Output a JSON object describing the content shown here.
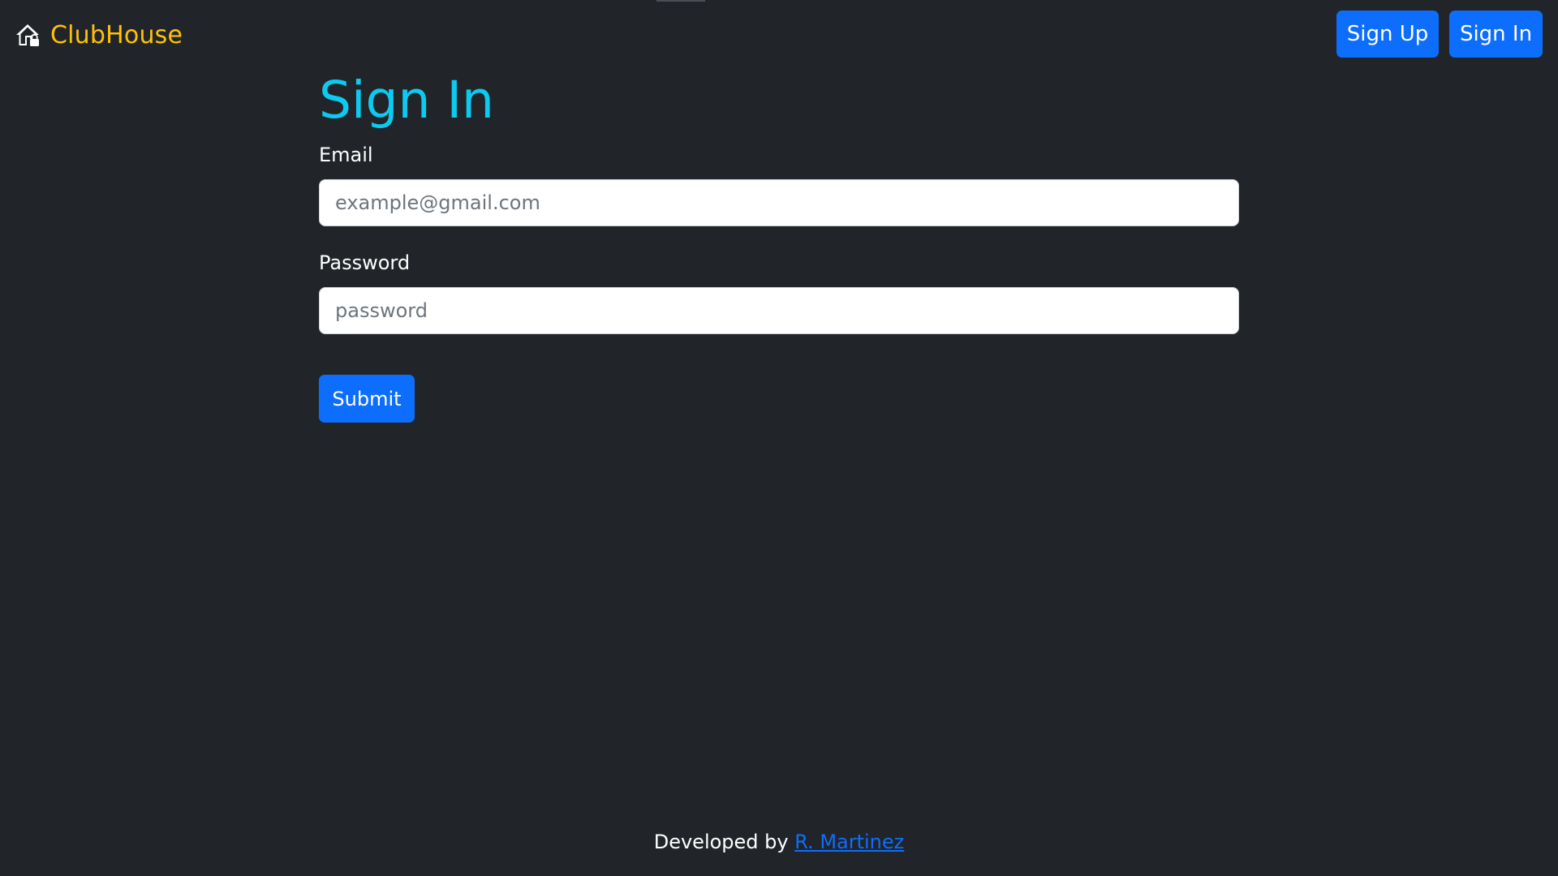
{
  "navbar": {
    "brand_text": "ClubHouse",
    "brand_icon": "house-lock-icon",
    "signup_label": "Sign Up",
    "signin_label": "Sign In"
  },
  "form": {
    "title": "Sign In",
    "email_label": "Email",
    "email_placeholder": "example@gmail.com",
    "email_value": "",
    "password_label": "Password",
    "password_placeholder": "password",
    "password_value": "",
    "submit_label": "Submit"
  },
  "footer": {
    "prefix": "Developed by ",
    "author_link": "R. Martinez"
  },
  "colors": {
    "background": "#212529",
    "brand": "#ffc107",
    "title": "#0dcaf0",
    "primary_button": "#0d6efd",
    "link": "#0d6efd"
  }
}
